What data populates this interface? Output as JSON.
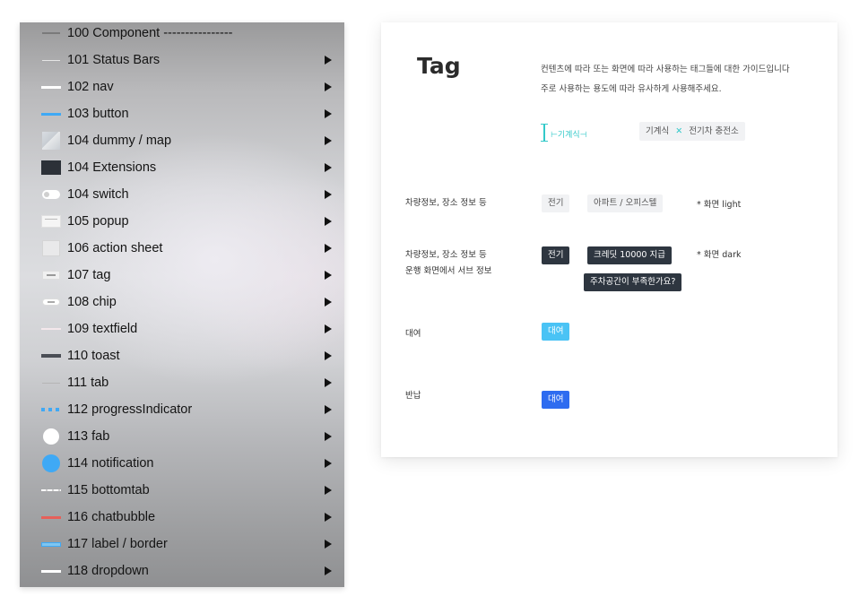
{
  "menu": {
    "items": [
      {
        "label": "100 Component ----------------",
        "has_arrow": false,
        "thumb": "tiny-text"
      },
      {
        "label": "101 Status Bars",
        "has_arrow": true,
        "thumb": "thin-line-light"
      },
      {
        "label": "102 nav",
        "has_arrow": true,
        "thumb": "white-bar"
      },
      {
        "label": "103 button",
        "has_arrow": true,
        "thumb": "blue-bar"
      },
      {
        "label": "104 dummy / map",
        "has_arrow": true,
        "thumb": "map-square"
      },
      {
        "label": "104 Extensions",
        "has_arrow": true,
        "thumb": "dark-square"
      },
      {
        "label": "104 switch",
        "has_arrow": true,
        "thumb": "switch-pill"
      },
      {
        "label": "105 popup",
        "has_arrow": true,
        "thumb": "popup-card"
      },
      {
        "label": "106 action sheet",
        "has_arrow": true,
        "thumb": "sheet-card"
      },
      {
        "label": "107 tag",
        "has_arrow": true,
        "thumb": "tag-chip"
      },
      {
        "label": "108 chip",
        "has_arrow": true,
        "thumb": "chip-pill"
      },
      {
        "label": "109 textfield",
        "has_arrow": true,
        "thumb": "field-line"
      },
      {
        "label": "110 toast",
        "has_arrow": true,
        "thumb": "dark-bar"
      },
      {
        "label": "111 tab",
        "has_arrow": true,
        "thumb": "tab-line"
      },
      {
        "label": "112 progressIndicator",
        "has_arrow": true,
        "thumb": "dotted-blue"
      },
      {
        "label": "113 fab",
        "has_arrow": true,
        "thumb": "white-circle"
      },
      {
        "label": "114 notification",
        "has_arrow": true,
        "thumb": "blue-circle"
      },
      {
        "label": "115 bottomtab",
        "has_arrow": true,
        "thumb": "white-bar-dotted"
      },
      {
        "label": "116 chatbubble",
        "has_arrow": true,
        "thumb": "red-bar"
      },
      {
        "label": "117 label / border",
        "has_arrow": true,
        "thumb": "blue-outline-bar"
      },
      {
        "label": "118 dropdown",
        "has_arrow": true,
        "thumb": "white-bar"
      }
    ]
  },
  "card": {
    "title": "Tag",
    "desc_line1": "컨텐츠에 따라 또는 화면에 따라 사용하는 태그들에 대한 가이드입니다",
    "desc_line2": "주로 사용하는 용도에 따라 유사하게 사용해주세요.",
    "spec_text": "⊢기계식⊣",
    "spec_sample_a": "기계식",
    "spec_sample_sep": "✕",
    "spec_sample_b": "전기차 충전소",
    "rows": {
      "light_label": "차량정보, 장소 정보 등",
      "light_tag1": "전기",
      "light_tag2": "아파트 / 오피스텔",
      "light_note": "* 화면 light",
      "dark_label1": "차량정보, 장소 정보 등",
      "dark_label2": "운행 화면에서 서브 정보",
      "dark_tag1": "전기",
      "dark_tag2": "크레딧 10000 지급",
      "dark_tag3": "주차공간이 부족한가요?",
      "dark_note": "* 화면 dark",
      "rent_label": "대여",
      "rent_tag": "대여",
      "return_label": "반납",
      "return_tag": "대여"
    }
  },
  "colors": {
    "cyan_tag": "#4ac3f5",
    "blue_tag": "#2e6cf0",
    "dark_tag": "#2e3640",
    "light_tag": "#f1f2f4",
    "spec_teal": "#33c9c9"
  }
}
